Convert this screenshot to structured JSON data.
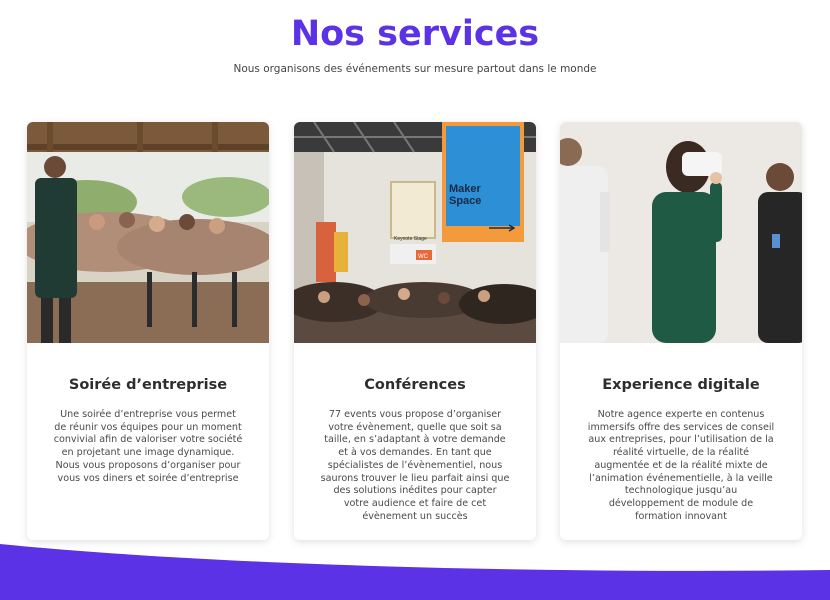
{
  "header": {
    "title": "Nos services",
    "subtitle": "Nous organisons des événements sur mesure partout dans le monde"
  },
  "colors": {
    "accent": "#5b32e5",
    "wave": "#5b32e5"
  },
  "cards": [
    {
      "image": "corporate-party-photo",
      "title": "Soirée d’entreprise",
      "text": "Une soirée d’entreprise vous permet de réunir vos équipes pour un moment convivial afin de valoriser votre société en projetant une image dynamique. Nous vous proposons d’organiser pour vous vos diners et soirée d’entreprise"
    },
    {
      "image": "conference-hall-photo",
      "title": "Conférences",
      "text": "77 events vous propose d’organiser votre évènement, quelle que soit sa taille, en s’adaptant à votre demande et à vos demandes. En tant que spécialistes de l’évènementiel, nous saurons trouver le lieu parfait ainsi que des solutions inédites pour capter votre audience et faire de cet évènement un succès",
      "signs": {
        "maker": "Maker Space",
        "keynote": "Keynote Stage",
        "wc": "WC"
      }
    },
    {
      "image": "virtual-reality-photo",
      "title": "Experience digitale",
      "text": "Notre agence experte en contenus immersifs offre des services de conseil aux entreprises, pour l’utilisation de la réalité virtuelle, de la réalité augmentée et de la réalité mixte de l’animation événementielle, à la veille technologique jusqu’au développement de module de formation innovant"
    }
  ]
}
